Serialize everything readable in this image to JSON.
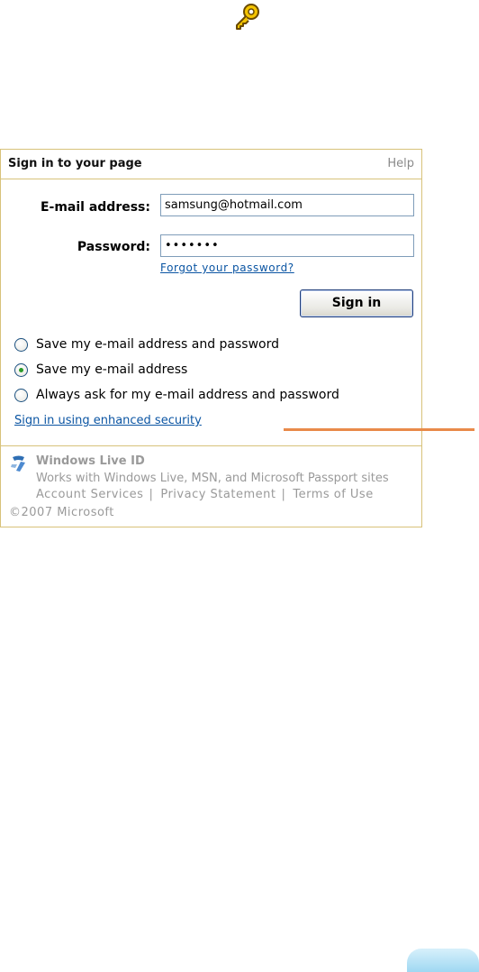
{
  "icons": {
    "key": "key-icon",
    "windows_live": "windows-live-id-icon"
  },
  "panel": {
    "title": "Sign in to your page",
    "help": "Help"
  },
  "form": {
    "email_label": "E-mail address:",
    "email_value": "samsung@hotmail.com",
    "password_label": "Password:",
    "password_value": "•••••••",
    "forgot_link": "Forgot your password?",
    "signin_button": "Sign in"
  },
  "options": [
    {
      "label": "Save my e-mail address and password",
      "checked": false
    },
    {
      "label": "Save my e-mail address",
      "checked": true
    },
    {
      "label": "Always ask for my e-mail address and password",
      "checked": false
    }
  ],
  "enhanced_security_link": "Sign in using enhanced security",
  "footer": {
    "brand": "Windows Live ID",
    "description": "Works with Windows Live, MSN, and Microsoft Passport sites",
    "links": [
      "Account Services",
      "Privacy Statement",
      "Terms of Use"
    ],
    "copyright": "©2007 Microsoft"
  },
  "colors": {
    "panel_border": "#d8c27a",
    "link": "#0b55a3",
    "callout": "#e98a4a",
    "muted_text": "#9a9a9a"
  }
}
